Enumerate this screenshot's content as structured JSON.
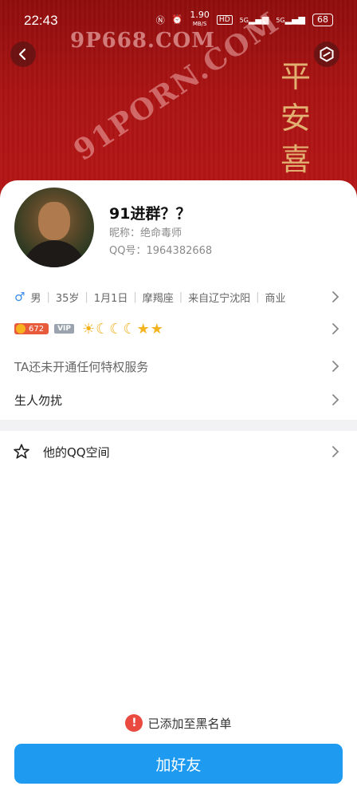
{
  "status_bar": {
    "time": "22:43",
    "network_speed": "1.90",
    "network_speed_unit": "MB/S",
    "hd_badge": "HD",
    "signal_1": "5G",
    "signal_2": "5G",
    "battery": "68"
  },
  "header": {
    "watermark": "9P668.COM",
    "calligraphy": [
      "平",
      "安",
      "喜"
    ],
    "diagonal_watermark": "91PORN.COM"
  },
  "profile": {
    "name": "91进群？？",
    "nickname_label": "昵称：",
    "nickname": "绝命毒师",
    "qq_label": "QQ号：",
    "qq_number": "1964382668"
  },
  "info": {
    "gender_icon": "♂",
    "gender": "男",
    "age": "35岁",
    "birthday": "1月1日",
    "zodiac": "摩羯座",
    "hometown": "来自辽宁沈阳",
    "occupation": "商业"
  },
  "badges": {
    "coin_count": "672",
    "vip_label": "VIP"
  },
  "rows": {
    "privilege": "TA还未开通任何特权服务",
    "stranger": "生人勿扰",
    "qzone": "他的QQ空间"
  },
  "footer": {
    "blacklist_icon": "!",
    "blacklist_text": "已添加至黑名单",
    "add_friend": "加好友"
  },
  "colors": {
    "header_red": "#a91313",
    "accent_blue": "#1e9bf0",
    "warning_red": "#ea4a3f",
    "gender_blue": "#3b8be8"
  }
}
